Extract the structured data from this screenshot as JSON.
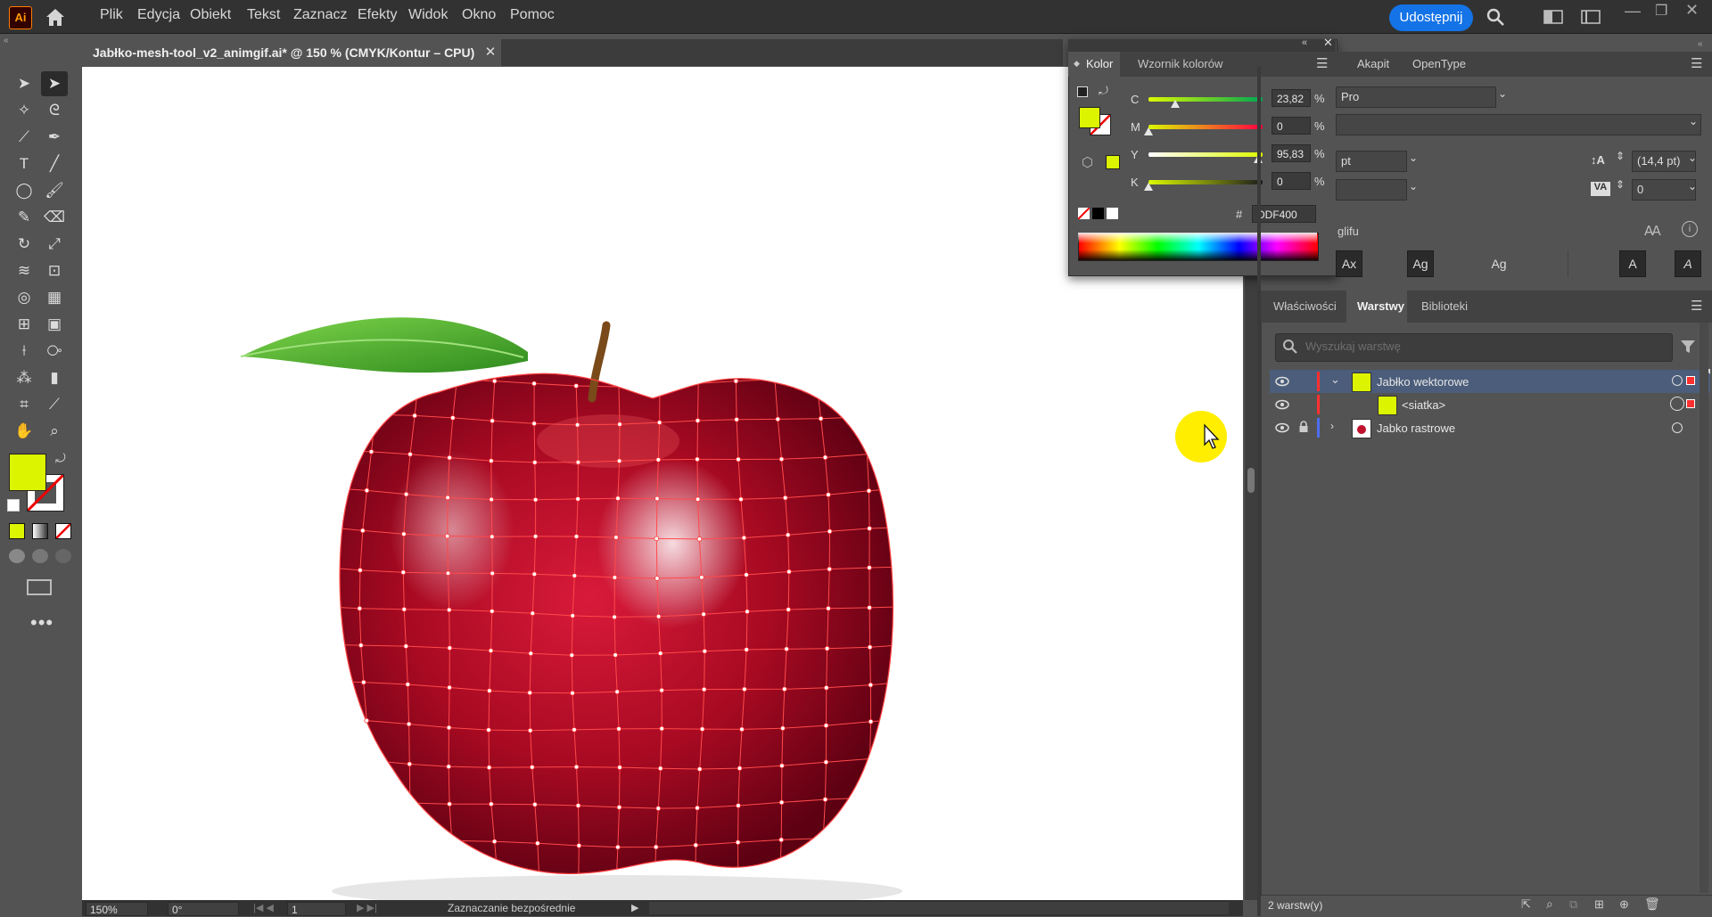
{
  "app": {
    "logo": "Ai",
    "menu": [
      "Plik",
      "Edycja",
      "Obiekt",
      "Tekst",
      "Zaznacz",
      "Efekty",
      "Widok",
      "Okno",
      "Pomoc"
    ],
    "share_label": "Udostępnij"
  },
  "document": {
    "tab_title": "Jabłko-mesh-tool_v2_animgif.ai* @ 150 % (CMYK/Kontur – CPU)",
    "close_glyph": "✕"
  },
  "colors": {
    "fill": "#DDF400",
    "mesh": "#ff3030",
    "accent": "#1473e6"
  },
  "color_panel": {
    "tabs": [
      "Kolor",
      "Wzornik kolorów"
    ],
    "sliders": [
      {
        "label": "C",
        "value": "23,82",
        "unit": "%",
        "fraction": 0.2382
      },
      {
        "label": "M",
        "value": "0",
        "unit": "%",
        "fraction": 0
      },
      {
        "label": "Y",
        "value": "95,83",
        "unit": "%",
        "fraction": 0.9583
      },
      {
        "label": "K",
        "value": "0",
        "unit": "%",
        "fraction": 0
      }
    ],
    "hex_prefix": "#",
    "hex_value": "DDF400"
  },
  "char_panel": {
    "tabs": [
      "Akapit",
      "OpenType"
    ],
    "font_name": "Pro",
    "size_unit": "pt",
    "leading": "(14,4 pt)",
    "tracking": "0",
    "glyph_label": "glifu",
    "glyph_buttons": [
      "Ax",
      "Ag",
      "Ag",
      "A",
      "A"
    ]
  },
  "layers_panel": {
    "tabs": [
      "Właściwości",
      "Warstwy",
      "Biblioteki"
    ],
    "active_tab": "Warstwy",
    "search_placeholder": "Wyszukaj warstwę",
    "layers": [
      {
        "name": "Jabłko wektorowe",
        "selected": true
      },
      {
        "name": "<siatka>",
        "selected": false
      },
      {
        "name": "Jabko rastrowe",
        "selected": false
      }
    ],
    "footer_count": "2 warstw(y)"
  },
  "status": {
    "zoom": "150%",
    "rotation": "0°",
    "artboard": "1",
    "tool_name": "Zaznaczanie bezpośrednie"
  }
}
